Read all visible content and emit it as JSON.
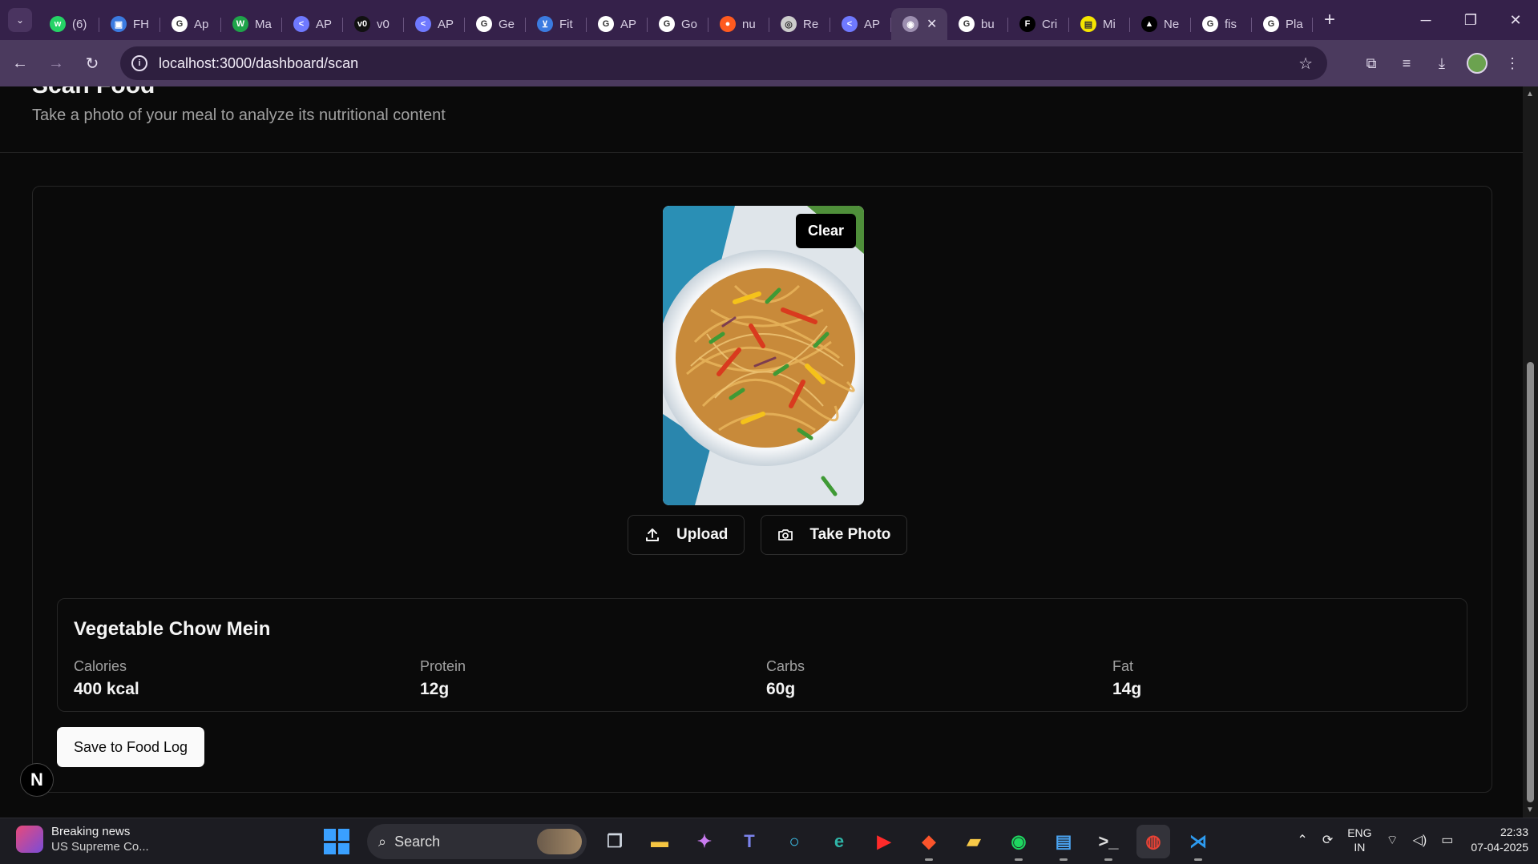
{
  "browser": {
    "tabs": [
      {
        "label": "(6)",
        "icon": "whatsapp-icon",
        "color": "#25d366",
        "glyph": "w"
      },
      {
        "label": "FH",
        "icon": "profile-card-icon",
        "color": "#3b7be0",
        "glyph": "▣"
      },
      {
        "label": "Ap",
        "icon": "google-icon",
        "color": "#ffffff",
        "glyph": "G"
      },
      {
        "label": "Ma",
        "icon": "w-logo-icon",
        "color": "#1fa34a",
        "glyph": "W"
      },
      {
        "label": "AP",
        "icon": "sendgrid-icon",
        "color": "#6f79ff",
        "glyph": "<"
      },
      {
        "label": "v0",
        "icon": "v0-icon",
        "color": "#111111",
        "glyph": "v0"
      },
      {
        "label": "AP",
        "icon": "sendgrid-icon",
        "color": "#6f79ff",
        "glyph": "<"
      },
      {
        "label": "Ge",
        "icon": "google-icon",
        "color": "#ffffff",
        "glyph": "G"
      },
      {
        "label": "Fit",
        "icon": "cart-icon",
        "color": "#3b7be0",
        "glyph": "⊻"
      },
      {
        "label": "AP",
        "icon": "google-icon",
        "color": "#ffffff",
        "glyph": "G"
      },
      {
        "label": "Go",
        "icon": "google-icon",
        "color": "#ffffff",
        "glyph": "G"
      },
      {
        "label": "nu",
        "icon": "flame-icon",
        "color": "#ff5a1f",
        "glyph": "●"
      },
      {
        "label": "Re",
        "icon": "replicate-icon",
        "color": "#cccccc",
        "glyph": "◎"
      },
      {
        "label": "AP",
        "icon": "sendgrid-icon",
        "color": "#6f79ff",
        "glyph": "<"
      },
      {
        "label": "",
        "icon": "globe-icon",
        "color": "#9d8fb0",
        "glyph": "◉",
        "active": true
      },
      {
        "label": "bu",
        "icon": "google-icon",
        "color": "#ffffff",
        "glyph": "G"
      },
      {
        "label": "Cri",
        "icon": "fw-icon",
        "color": "#000000",
        "glyph": "F"
      },
      {
        "label": "Mi",
        "icon": "mi-icon",
        "color": "#f5e500",
        "glyph": "▤"
      },
      {
        "label": "Ne",
        "icon": "triangle-icon",
        "color": "#000000",
        "glyph": "▲"
      },
      {
        "label": "fis",
        "icon": "google-icon",
        "color": "#ffffff",
        "glyph": "G"
      },
      {
        "label": "Pla",
        "icon": "google-icon",
        "color": "#ffffff",
        "glyph": "G"
      }
    ],
    "url": "localhost:3000/dashboard/scan"
  },
  "page": {
    "title": "Scan Food",
    "subtitle": "Take a photo of your meal to analyze its nutritional content",
    "clear_label": "Clear",
    "upload_label": "Upload",
    "take_photo_label": "Take Photo",
    "food_name": "Vegetable Chow Mein",
    "nutrition": [
      {
        "label": "Calories",
        "value": "400 kcal"
      },
      {
        "label": "Protein",
        "value": "12g"
      },
      {
        "label": "Carbs",
        "value": "60g"
      },
      {
        "label": "Fat",
        "value": "14g"
      }
    ],
    "save_label": "Save to Food Log",
    "badge": "N"
  },
  "taskbar": {
    "news_title": "Breaking news",
    "news_sub": "US Supreme Co...",
    "search_placeholder": "Search",
    "lang_1": "ENG",
    "lang_2": "IN",
    "time": "22:33",
    "date": "07-04-2025"
  }
}
